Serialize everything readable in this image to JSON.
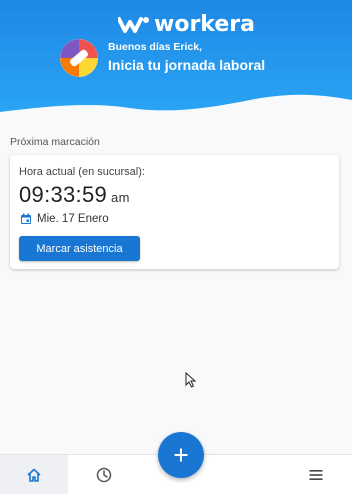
{
  "header": {
    "brand": "workera",
    "greeting": "Buenos días Erick,",
    "subtitle": "Inicia tu jornada laboral"
  },
  "next_punch": {
    "section_title": "Próxima marcación",
    "label": "Hora actual (en sucursal):",
    "time": "09:33:59",
    "ampm": "am",
    "date": "Mie. 17 Enero",
    "button_label": "Marcar asistencia"
  },
  "bottom_nav": {
    "items": [
      {
        "icon": "home-icon",
        "active": true
      },
      {
        "icon": "clock-icon",
        "active": false
      },
      {
        "icon": "menu-icon",
        "active": false
      }
    ],
    "fab_icon": "plus-icon"
  },
  "colors": {
    "primary": "#1976d2",
    "header": "#2196f3"
  }
}
